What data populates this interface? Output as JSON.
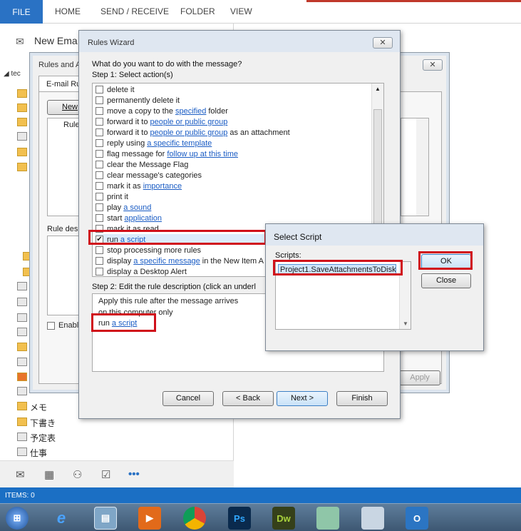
{
  "ribbon": {
    "tabs": [
      "FILE",
      "HOME",
      "SEND / RECEIVE",
      "FOLDER",
      "VIEW"
    ]
  },
  "left": {
    "new_email_label": "New Ema",
    "account_label": "tec",
    "nav_items": [
      "メモ",
      "下書き",
      "予定表",
      "仕事"
    ],
    "bottom_icons": [
      "mail-icon",
      "calendar-icon",
      "people-icon",
      "tasks-icon",
      "more-icon"
    ],
    "more_label": "•••"
  },
  "rules_alerts": {
    "title": "Rules and A",
    "tab_label": "E-mail Ru",
    "new_button": "New",
    "column_rule": "Rule",
    "rule_desc_label": "Rule des",
    "enable_label": "Enabl",
    "apply_button": "Apply",
    "close_x": "✕"
  },
  "wizard": {
    "title": "Rules Wizard",
    "close_x": "✕",
    "question": "What do you want to do with the message?",
    "step1": "Step 1: Select action(s)",
    "actions": [
      {
        "pre": "delete it",
        "link": "",
        "post": "",
        "checked": false
      },
      {
        "pre": "permanently delete it",
        "link": "",
        "post": "",
        "checked": false
      },
      {
        "pre": "move a copy to the",
        "link": "specified",
        "post": "folder",
        "checked": false
      },
      {
        "pre": "forward it to",
        "link": "people or public group",
        "post": "",
        "checked": false
      },
      {
        "pre": "forward it to",
        "link": "people or public group",
        "post": "as an attachment",
        "checked": false
      },
      {
        "pre": "reply using",
        "link": "a specific template",
        "post": "",
        "checked": false
      },
      {
        "pre": "flag message for",
        "link": "follow up at this time",
        "post": "",
        "checked": false
      },
      {
        "pre": "clear the Message Flag",
        "link": "",
        "post": "",
        "checked": false
      },
      {
        "pre": "clear message's categories",
        "link": "",
        "post": "",
        "checked": false
      },
      {
        "pre": "mark it as",
        "link": "importance",
        "post": "",
        "checked": false
      },
      {
        "pre": "print it",
        "link": "",
        "post": "",
        "checked": false
      },
      {
        "pre": "play",
        "link": "a sound",
        "post": "",
        "checked": false
      },
      {
        "pre": "start",
        "link": "application",
        "post": "",
        "checked": false
      },
      {
        "pre": "mark it as read",
        "link": "",
        "post": "",
        "checked": false
      },
      {
        "pre": "run",
        "link": "a script",
        "post": "",
        "checked": true
      },
      {
        "pre": "stop processing more rules",
        "link": "",
        "post": "",
        "checked": false
      },
      {
        "pre": "display",
        "link": "a specific message",
        "post": "in the New Item A",
        "checked": false
      },
      {
        "pre": "display a Desktop Alert",
        "link": "",
        "post": "",
        "checked": false
      }
    ],
    "step2": "Step 2: Edit the rule description (click an underl",
    "desc_line1": "Apply this rule after the message arrives",
    "desc_line2": "on this computer only",
    "desc_run": "run",
    "desc_link": "a script",
    "buttons": {
      "cancel": "Cancel",
      "back": "< Back",
      "next": "Next >",
      "finish": "Finish"
    }
  },
  "select_script": {
    "title": "Select Script",
    "scripts_label": "Scripts:",
    "scripts": [
      "Project1.SaveAttachmentsToDisk"
    ],
    "ok": "OK",
    "close": "Close"
  },
  "status": {
    "items": "ITEMS: 0"
  },
  "taskbar": {
    "apps": [
      "start-orb",
      "ie-icon",
      "explorer-icon",
      "media-icon",
      "chrome-icon",
      "photoshop-icon",
      "dreamweaver-icon",
      "folder-icon",
      "network-icon",
      "outlook-icon"
    ],
    "ps": "Ps",
    "dw": "Dw"
  },
  "colors": {
    "accent": "#2a72c4",
    "highlight": "#d0101a",
    "link": "#1a5cc4"
  }
}
